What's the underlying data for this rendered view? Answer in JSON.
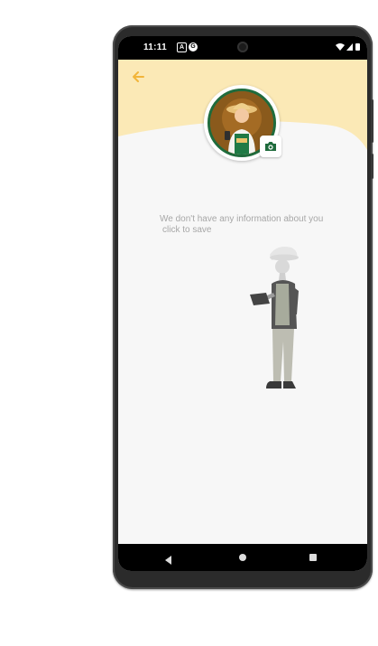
{
  "status_bar": {
    "time": "11:11",
    "notification_a": "A",
    "notification_g": "G"
  },
  "colors": {
    "header_yellow": "#fbe9b6",
    "accent_orange": "#f2b53a",
    "avatar_border_green": "#1f6b3c",
    "camera_icon_green": "#1f6b3c",
    "info_text": "#a7a7a7"
  },
  "header": {
    "back_icon": "arrow-left-icon"
  },
  "profile": {
    "avatar": "farmer-avatar",
    "photo_button_icon": "camera-icon"
  },
  "empty_state": {
    "message_line1": "We don't have any information about you",
    "message_line2": "click to save",
    "illustration": "person-with-tablet-illustration"
  },
  "nav_bar": {
    "back_icon": "nav-back-icon",
    "home_icon": "nav-home-icon",
    "recent_icon": "nav-recent-icon"
  }
}
